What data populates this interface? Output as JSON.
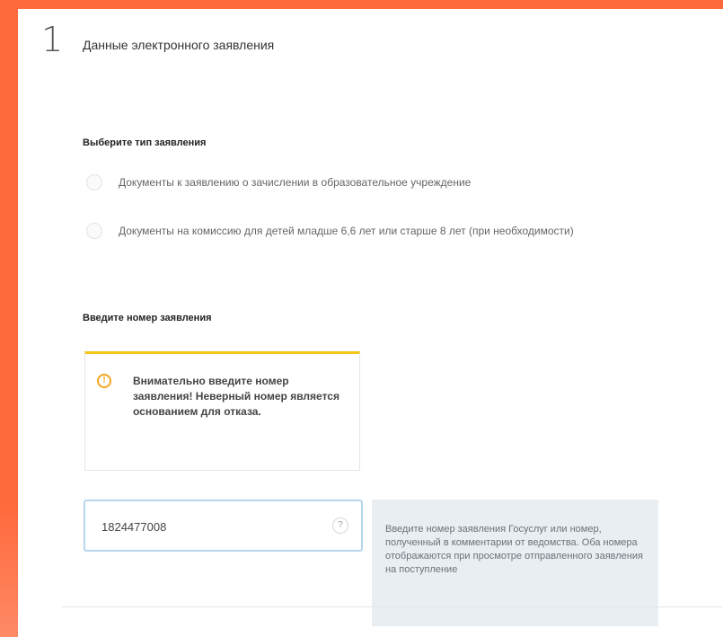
{
  "step": {
    "number": "1",
    "title": "Данные электронного заявления"
  },
  "type_section": {
    "heading": "Выберите тип заявления",
    "options": [
      {
        "label": "Документы к заявлению о зачислении в образовательное учреждение",
        "selected": false
      },
      {
        "label": "Документы на комиссию для детей младше 6,6 лет или старше 8 лет (при необходимости)",
        "selected": false
      }
    ]
  },
  "number_section": {
    "heading": "Введите номер заявления",
    "warning_icon": "!",
    "warning": "Внимательно введите номер заявления! Неверный номер является основанием для отказа.",
    "input_value": "1824477008",
    "help_icon": "?",
    "tooltip": "Введите номер заявления Госуслуг или номер, полученный в комментарии от ведомства. Оба номера отображаются при просмотре отправленного заявления на поступление"
  },
  "colors": {
    "accent_orange": "#ff6a3d",
    "warning_yellow": "#f5c518",
    "input_border": "#b7d6ee",
    "tooltip_bg": "#e9eef2"
  }
}
